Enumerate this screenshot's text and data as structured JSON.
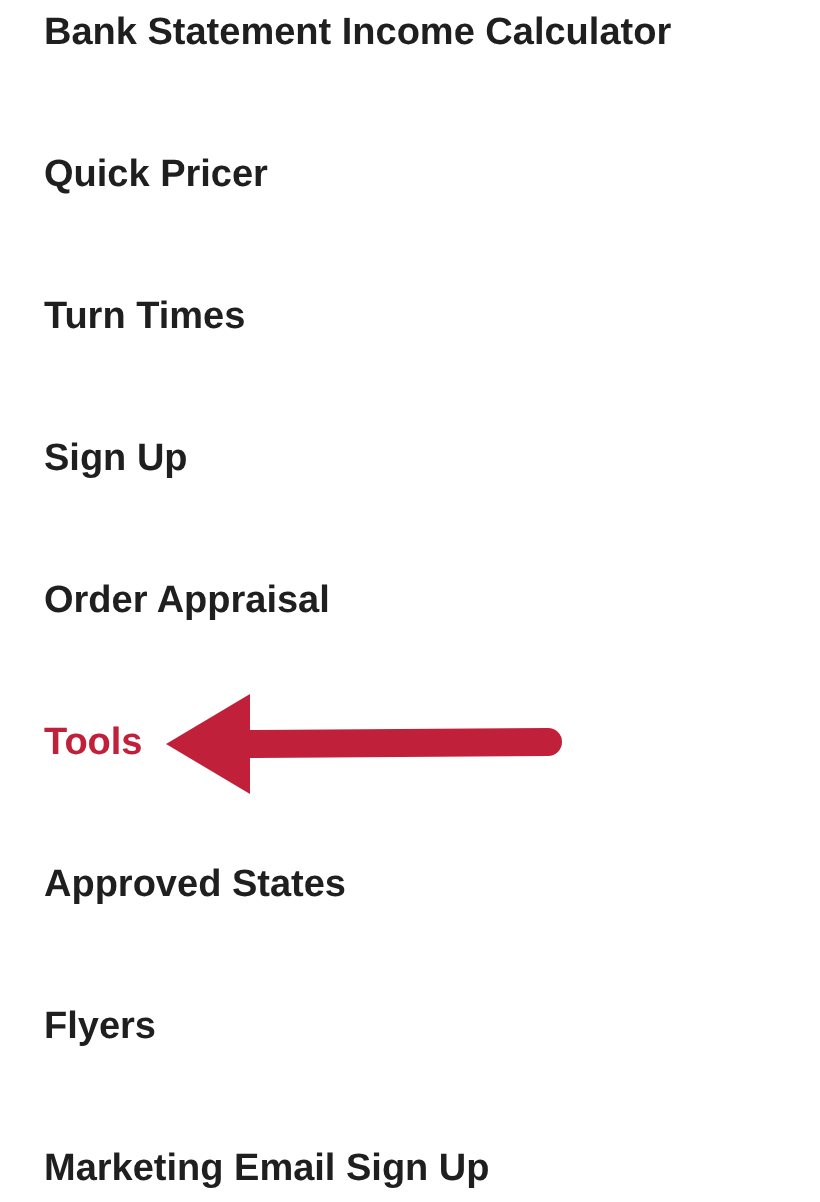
{
  "menu": {
    "items": [
      {
        "label": "Bank Statement Income Calculator",
        "selected": false,
        "pointed_at": false
      },
      {
        "label": "Quick Pricer",
        "selected": false,
        "pointed_at": false
      },
      {
        "label": "Turn Times",
        "selected": false,
        "pointed_at": false
      },
      {
        "label": "Sign Up",
        "selected": false,
        "pointed_at": false
      },
      {
        "label": "Order Appraisal",
        "selected": false,
        "pointed_at": false
      },
      {
        "label": "Tools",
        "selected": true,
        "pointed_at": true
      },
      {
        "label": "Approved States",
        "selected": false,
        "pointed_at": false
      },
      {
        "label": "Flyers",
        "selected": false,
        "pointed_at": false
      },
      {
        "label": "Marketing Email Sign Up",
        "selected": false,
        "pointed_at": false
      }
    ]
  }
}
